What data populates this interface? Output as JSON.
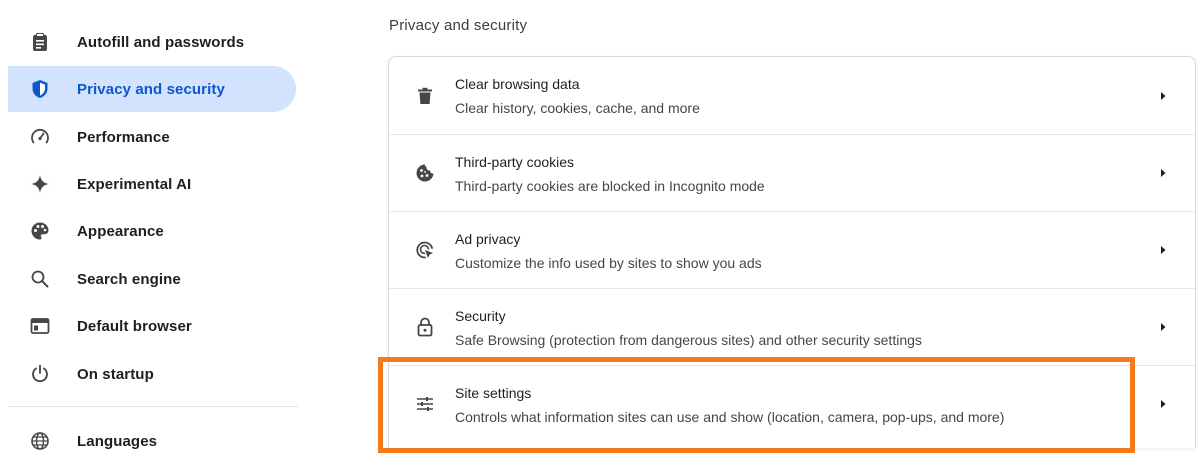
{
  "sidebar": {
    "items": [
      {
        "label": "Autofill and passwords",
        "icon": "clipboard-icon"
      },
      {
        "label": "Privacy and security",
        "icon": "shield-icon",
        "active": true
      },
      {
        "label": "Performance",
        "icon": "speedometer-icon"
      },
      {
        "label": "Experimental AI",
        "icon": "sparkle-icon"
      },
      {
        "label": "Appearance",
        "icon": "palette-icon"
      },
      {
        "label": "Search engine",
        "icon": "search-icon"
      },
      {
        "label": "Default browser",
        "icon": "browser-window-icon"
      },
      {
        "label": "On startup",
        "icon": "power-icon"
      },
      {
        "label": "Languages",
        "icon": "globe-icon"
      }
    ]
  },
  "main": {
    "section_title": "Privacy and security",
    "rows": [
      {
        "title": "Clear browsing data",
        "subtitle": "Clear history, cookies, cache, and more",
        "icon": "trash-icon"
      },
      {
        "title": "Third-party cookies",
        "subtitle": "Third-party cookies are blocked in Incognito mode",
        "icon": "cookie-icon"
      },
      {
        "title": "Ad privacy",
        "subtitle": "Customize the info used by sites to show you ads",
        "icon": "ad-privacy-icon"
      },
      {
        "title": "Security",
        "subtitle": "Safe Browsing (protection from dangerous sites) and other security settings",
        "icon": "lock-icon"
      },
      {
        "title": "Site settings",
        "subtitle": "Controls what information sites can use and show (location, camera, pop-ups, and more)",
        "icon": "sliders-icon"
      }
    ]
  },
  "colors": {
    "active_bg": "#d3e3fd",
    "active_text": "#0b57d0",
    "highlight": "#f47a20"
  }
}
